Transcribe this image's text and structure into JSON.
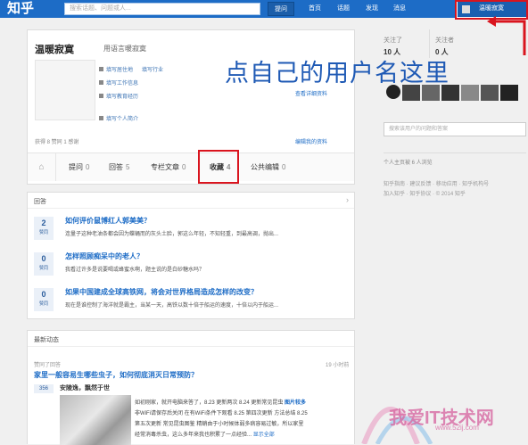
{
  "topbar": {
    "logo": "知乎",
    "search_placeholder": "搜索话题、问题或人...",
    "ask_label": "提问",
    "nav": [
      "首页",
      "话题",
      "发现",
      "消息"
    ],
    "username": "温暖寂寞"
  },
  "annotation": {
    "instruction": "点自己的用户名这里",
    "color": "#d9141e"
  },
  "profile": {
    "name": "温暖寂寞",
    "tagline": "用语言暖寂寞",
    "info": [
      "填写居住地",
      "填写行业",
      "填写工作信息",
      "填写教育经历",
      "填写个人简介"
    ],
    "view_more": "查看详细资料",
    "stats": "获得 8 赞同 1 感谢",
    "edit": "编辑我的资料"
  },
  "tabs": [
    {
      "label": "提问",
      "count": "0"
    },
    {
      "label": "回答",
      "count": "5"
    },
    {
      "label": "专栏文章",
      "count": "0"
    },
    {
      "label": "收藏",
      "count": "4"
    },
    {
      "label": "公共编辑",
      "count": "0"
    }
  ],
  "answers": {
    "title": "回答",
    "items": [
      {
        "votes": "2",
        "vote_label": "赞同",
        "question": "如何评价鼠博红人郭美美？",
        "snippet": "连量子这种老油条都会因为蝶蛹而的灰头土脸，郭这么年轻，不知轻重，到最高调，抛出..."
      },
      {
        "votes": "0",
        "vote_label": "赞同",
        "question": "怎样照顾痴呆中的老人？",
        "snippet": "我看过许多是说要喝或蜂蜜水啊，题主说的是白砂糖水吗？"
      },
      {
        "votes": "0",
        "vote_label": "赞同",
        "question": "如果中国建成全球高铁网，将会对世界格局造成怎样的改变？",
        "snippet": "现在是谁控制了海洋就是霸主，当某一天，高铁以数十倍于船运的速度，十倍以内于船运..."
      }
    ]
  },
  "activity": {
    "title": "最新动态",
    "meta": "赞同了回答",
    "time": "19 小时前",
    "question": "家里一般容易生哪些虫子，如何彻底消灭日常预防？",
    "votes": "356",
    "answer_title": "安陵逸，飘然于世",
    "text1": "如初刚家，就开电脑来答了，8.23 更新两次 8.24 更新常见昆虫",
    "text1_bold": "图片较多",
    "text2": "非WiFi请保存后关闭 在有WiFi条件下观看 8.25 第四次更新 方法总结 8.25",
    "text3": "第五次更新 常见昆虫图鉴 精蛸由于小时候体弱多病容易过敏，所以家里",
    "text4": "经常消毒杀虫，这么多年来我也积累了一点经验...",
    "show_all": "显示全部"
  },
  "sidebar": {
    "following_label": "关注了",
    "following_count": "10 人",
    "followers_label": "关注者",
    "followers_count": "0 人",
    "search_placeholder": "搜索该用户的问题和答案",
    "views": "个人主页被 6 人浏览",
    "links1": [
      "知乎指南",
      "建议反馈",
      "移动应用",
      "知乎机构号"
    ],
    "links2": [
      "加入知乎",
      "知乎协议",
      "© 2014 知乎"
    ]
  },
  "watermark": {
    "text": "我爱IT技术网",
    "url": "www.52ij.com"
  }
}
